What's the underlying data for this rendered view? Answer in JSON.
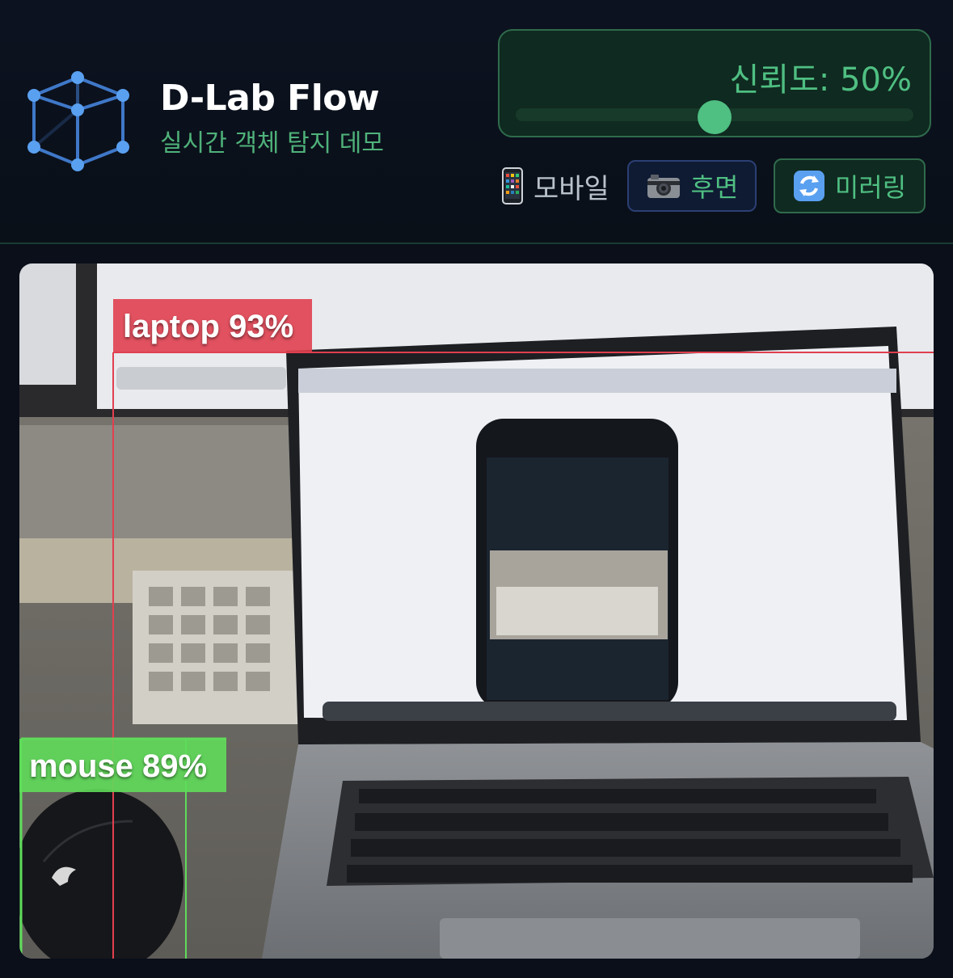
{
  "app": {
    "title": "D-Lab Flow",
    "subtitle": "실시간 객체 탐지 데모"
  },
  "confidence": {
    "label": "신뢰도: 50%",
    "value": 0.5
  },
  "device": {
    "icon": "mobile-phone-icon",
    "label": "모바일"
  },
  "buttons": {
    "camera": {
      "icon": "camera-icon",
      "label": "후면"
    },
    "mirror": {
      "icon": "refresh-icon",
      "label": "미러링"
    }
  },
  "detections": [
    {
      "label": "laptop 93%",
      "color": "#e0404f"
    },
    {
      "label": "mouse 89%",
      "color": "#5fdc5a"
    }
  ],
  "colors": {
    "accent": "#4fbf82",
    "background": "#0a0f1a"
  }
}
